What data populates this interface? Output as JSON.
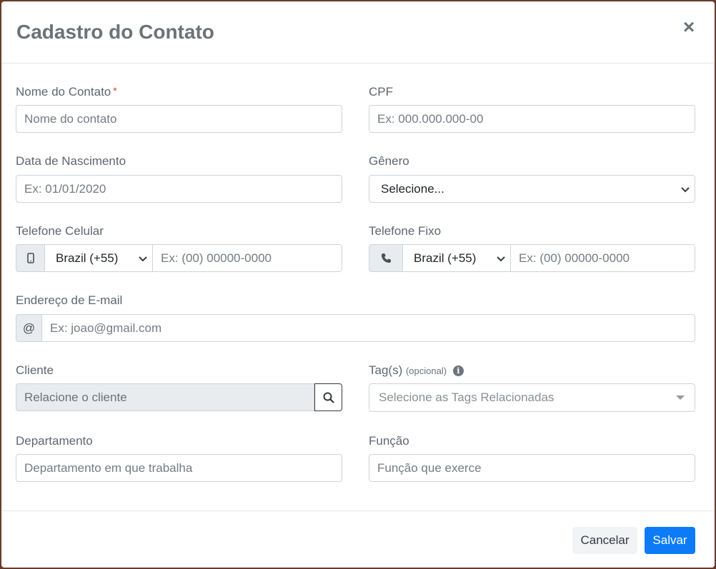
{
  "modal": {
    "title": "Cadastro do Contato",
    "close_glyph": "×"
  },
  "fields": {
    "nome": {
      "label": "Nome do Contato",
      "required_mark": "*",
      "placeholder": "Nome do contato"
    },
    "cpf": {
      "label": "CPF",
      "placeholder": "Ex: 000.000.000-00"
    },
    "nascimento": {
      "label": "Data de Nascimento",
      "placeholder": "Ex: 01/01/2020"
    },
    "genero": {
      "label": "Gênero",
      "selected": "Selecione..."
    },
    "celular": {
      "label": "Telefone Celular",
      "country": "Brazil (+55)",
      "placeholder": "Ex: (00) 00000-0000",
      "icon": "mobile-phone-icon"
    },
    "fixo": {
      "label": "Telefone Fixo",
      "country": "Brazil (+55)",
      "placeholder": "Ex: (00) 00000-0000",
      "icon": "phone-icon"
    },
    "email": {
      "label": "Endereço de E-mail",
      "addon": "@",
      "placeholder": "Ex: joao@gmail.com"
    },
    "cliente": {
      "label": "Cliente",
      "placeholder": "Relacione o cliente",
      "button_icon": "search-icon"
    },
    "tags": {
      "label": "Tag(s)",
      "label_note": "(opcional)",
      "info_glyph": "i",
      "placeholder": "Selecione as Tags Relacionadas"
    },
    "departamento": {
      "label": "Departamento",
      "placeholder": "Departamento em que trabalha"
    },
    "funcao": {
      "label": "Função",
      "placeholder": "Função que exerce"
    }
  },
  "footer": {
    "cancel_label": "Cancelar",
    "save_label": "Salvar"
  },
  "colors": {
    "primary": "#0d7bf5",
    "required": "#e53935",
    "addon_bg": "#e9ecef"
  }
}
